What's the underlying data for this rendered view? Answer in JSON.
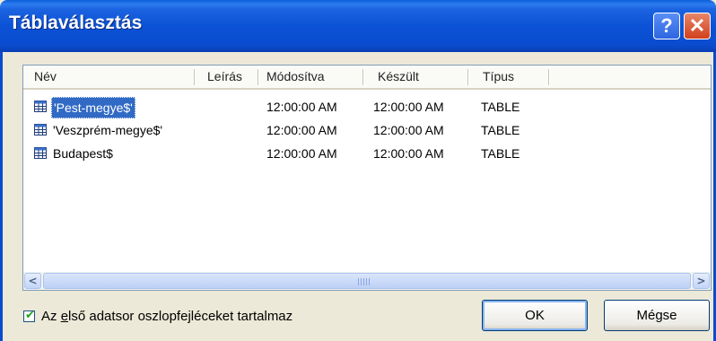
{
  "window": {
    "title": "Táblaválasztás"
  },
  "titlebar": {
    "help_glyph": "?",
    "close_glyph": "✕"
  },
  "columns": [
    "Név",
    "Leírás",
    "Módosítva",
    "Készült",
    "Típus"
  ],
  "rows": [
    {
      "name": "'Pest-megye$'",
      "description": "",
      "modified": "12:00:00 AM",
      "created": "12:00:00 AM",
      "type": "TABLE",
      "selected": true
    },
    {
      "name": "'Veszprém-megye$'",
      "description": "",
      "modified": "12:00:00 AM",
      "created": "12:00:00 AM",
      "type": "TABLE",
      "selected": false
    },
    {
      "name": "Budapest$",
      "description": "",
      "modified": "12:00:00 AM",
      "created": "12:00:00 AM",
      "type": "TABLE",
      "selected": false
    }
  ],
  "scrollbar": {
    "left_arrow": "<",
    "right_arrow": ">"
  },
  "checkbox": {
    "label_before": "Az ",
    "label_accel": "e",
    "label_after": "lső adatsor oszlopfejléceket tartalmaz",
    "checked": true
  },
  "buttons": {
    "ok": "OK",
    "cancel": "Mégse"
  },
  "icons": {
    "table": "table-icon",
    "help": "help-icon",
    "close": "close-icon",
    "check": "check-icon"
  },
  "colors": {
    "title_bar": "#0a4ccf",
    "selection": "#316ac5",
    "face": "#ece9d8"
  }
}
